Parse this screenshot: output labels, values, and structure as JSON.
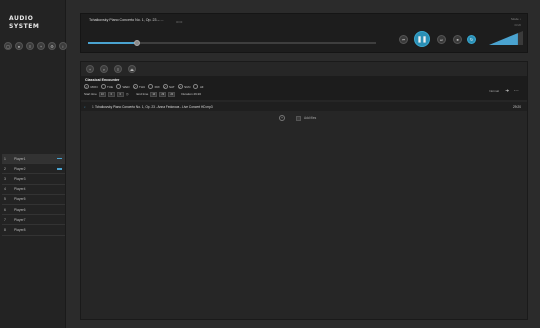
{
  "app": {
    "logo_text": "AUDIO SYSTEM"
  },
  "sidebar": {
    "toolbar_icons": [
      "new-icon",
      "record-icon",
      "list-icon",
      "add-icon",
      "settings-icon",
      "info-icon"
    ],
    "players": [
      {
        "num": "1",
        "name": "Player1",
        "active": true,
        "indicator": true
      },
      {
        "num": "2",
        "name": "Player2",
        "active": false,
        "indicator": true
      },
      {
        "num": "3",
        "name": "Player3",
        "active": false,
        "indicator": false
      },
      {
        "num": "4",
        "name": "Player4",
        "active": false,
        "indicator": false
      },
      {
        "num": "5",
        "name": "Player5",
        "active": false,
        "indicator": false
      },
      {
        "num": "6",
        "name": "Player6",
        "active": false,
        "indicator": false
      },
      {
        "num": "7",
        "name": "Player7",
        "active": false,
        "indicator": false
      },
      {
        "num": "8",
        "name": "Player8",
        "active": false,
        "indicator": false
      }
    ]
  },
  "now_playing": {
    "title": "Tchaikovsky Piano Concerto No. 1, Op. 23 – ...",
    "subtitle": "00:00",
    "mode": "Mode ↓",
    "time": "03:20",
    "progress": 0.17,
    "controls": {
      "prev": "⏮",
      "play": "❚❚",
      "next": "⏭",
      "stop": "■",
      "loop": "↻"
    },
    "volume": 0.85
  },
  "playlist": {
    "toolbar_icons": [
      "add-icon",
      "search-icon",
      "list-icon",
      "eject-icon"
    ],
    "name": "Classical Encounter",
    "days": [
      {
        "label": "MON",
        "checked": true
      },
      {
        "label": "TUE",
        "checked": false
      },
      {
        "label": "WED",
        "checked": false
      },
      {
        "label": "THU",
        "checked": true
      },
      {
        "label": "FRI",
        "checked": false
      },
      {
        "label": "SAT",
        "checked": true
      },
      {
        "label": "SUN",
        "checked": true
      },
      {
        "label": "All",
        "checked": false
      }
    ],
    "start_label": "Start time",
    "start_time": [
      "10",
      "0",
      "0"
    ],
    "end_label": "End time",
    "end_time": [
      "10",
      "29",
      "20"
    ],
    "duration_label": "Duration 29:20",
    "mode_select": "Normal",
    "more": "...",
    "tracks": [
      {
        "index": "1",
        "name": "Tchaikovsky Piano Concerto No. 1, Op. 23 - Anna Fedorova - Live Concert HD.mp3",
        "duration": "29:20"
      }
    ],
    "add_files_label": "Add files"
  },
  "colors": {
    "accent": "#2a8fb5",
    "background": "#2b2b2b",
    "panel": "#1c1c1c"
  }
}
